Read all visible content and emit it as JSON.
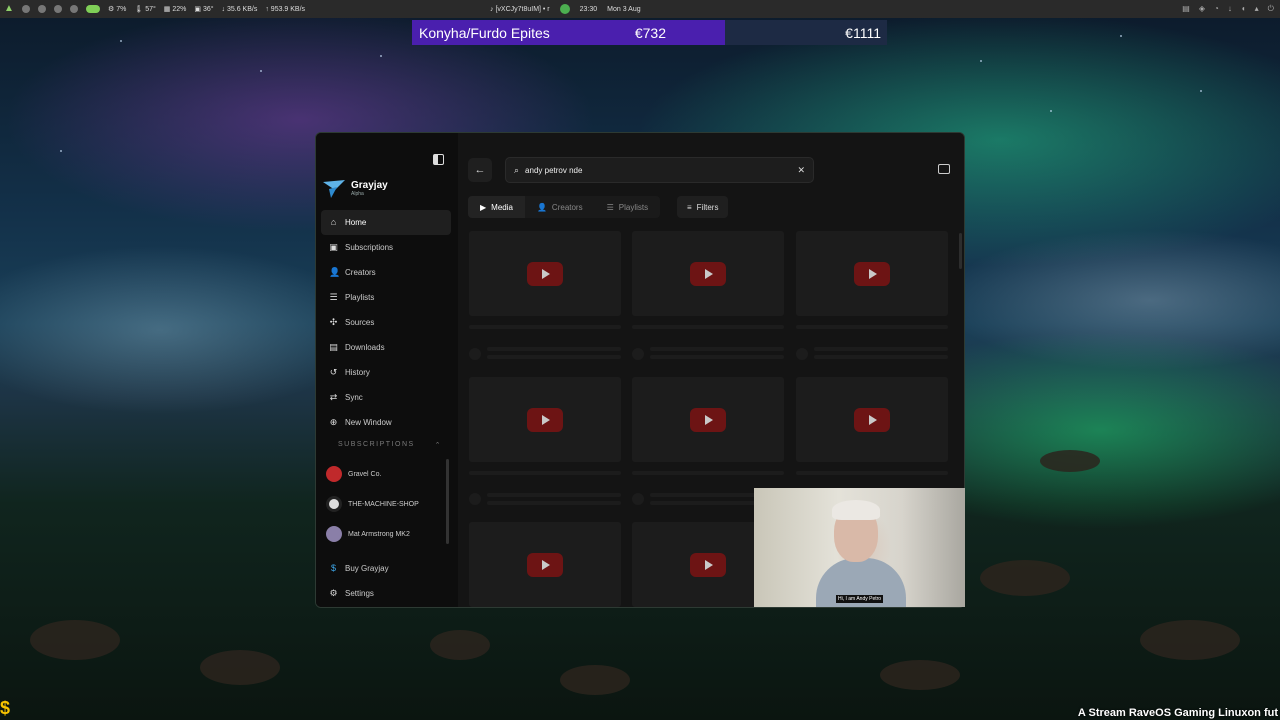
{
  "topbar": {
    "cpu": "7%",
    "temp": "57°",
    "mem": "22%",
    "gpu_temp": "36°",
    "net_down": "35.6 KB/s",
    "net_up": "953.9 KB/s",
    "media": "[vXCJy7t8uIM] • r",
    "time": "23:30",
    "date": "Mon 3 Aug"
  },
  "ticker": {
    "label": "Konyha/Furdo Epites",
    "value_current": "€732",
    "value_goal": "€1111"
  },
  "app": {
    "brand_name": "Grayjay",
    "brand_sub": "Alpha",
    "nav": [
      {
        "label": "Home",
        "icon": "home-icon"
      },
      {
        "label": "Subscriptions",
        "icon": "subscriptions-icon"
      },
      {
        "label": "Creators",
        "icon": "creators-icon"
      },
      {
        "label": "Playlists",
        "icon": "playlists-icon"
      },
      {
        "label": "Sources",
        "icon": "sources-icon"
      },
      {
        "label": "Downloads",
        "icon": "downloads-icon"
      },
      {
        "label": "History",
        "icon": "history-icon"
      },
      {
        "label": "Sync",
        "icon": "sync-icon"
      },
      {
        "label": "New Window",
        "icon": "plus-icon"
      }
    ],
    "subscriptions_header": "SUBSCRIPTIONS",
    "subscriptions": [
      {
        "name": "Gravel Co."
      },
      {
        "name": "THE-MACHINE-SHOP"
      },
      {
        "name": "Mat Armstrong MK2"
      }
    ],
    "bottom_nav": [
      {
        "label": "Buy Grayjay"
      },
      {
        "label": "Settings"
      }
    ],
    "search_value": "andy petrov nde",
    "tabs": [
      "Media",
      "Creators",
      "Playlists"
    ],
    "filters_label": "Filters"
  },
  "webcam_caption": "Hi, I am Andy Petro",
  "stream_text": "A Stream RaveOS Gaming Linuxon fut",
  "dollar": "$"
}
